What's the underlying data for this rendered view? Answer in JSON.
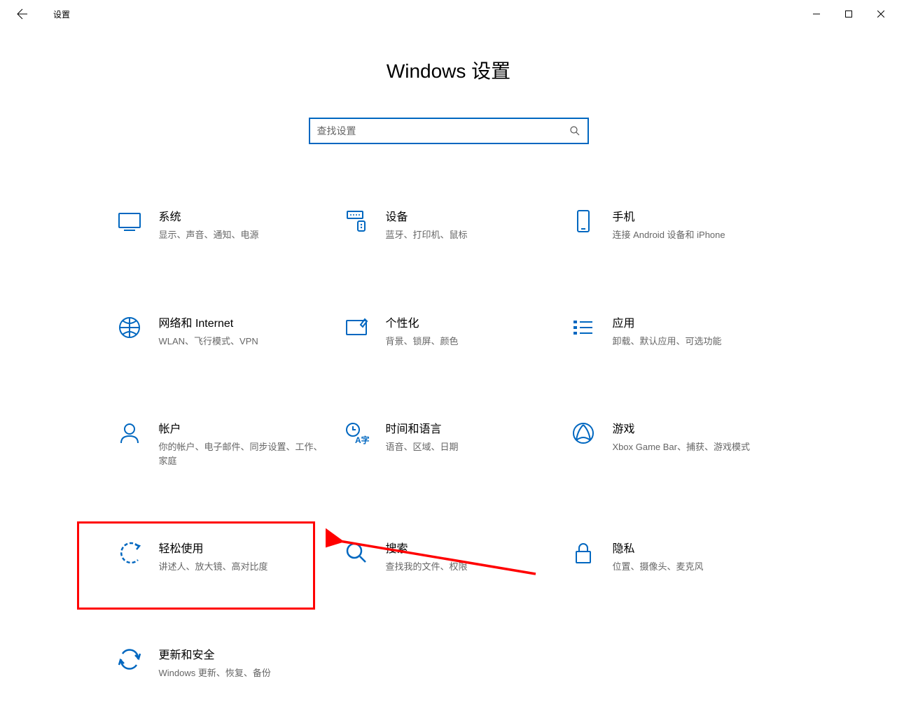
{
  "window": {
    "title": "设置"
  },
  "header": {
    "main_title": "Windows 设置"
  },
  "search": {
    "placeholder": "查找设置"
  },
  "tiles": [
    {
      "title": "系统",
      "subtitle": "显示、声音、通知、电源"
    },
    {
      "title": "设备",
      "subtitle": "蓝牙、打印机、鼠标"
    },
    {
      "title": "手机",
      "subtitle": "连接 Android 设备和 iPhone"
    },
    {
      "title": "网络和 Internet",
      "subtitle": "WLAN、飞行模式、VPN"
    },
    {
      "title": "个性化",
      "subtitle": "背景、锁屏、颜色"
    },
    {
      "title": "应用",
      "subtitle": "卸载、默认应用、可选功能"
    },
    {
      "title": "帐户",
      "subtitle": "你的帐户、电子邮件、同步设置、工作、家庭"
    },
    {
      "title": "时间和语言",
      "subtitle": "语音、区域、日期"
    },
    {
      "title": "游戏",
      "subtitle": "Xbox Game Bar、捕获、游戏模式"
    },
    {
      "title": "轻松使用",
      "subtitle": "讲述人、放大镜、高对比度"
    },
    {
      "title": "搜索",
      "subtitle": "查找我的文件、权限"
    },
    {
      "title": "隐私",
      "subtitle": "位置、摄像头、麦克风"
    },
    {
      "title": "更新和安全",
      "subtitle": "Windows 更新、恢复、备份"
    }
  ]
}
